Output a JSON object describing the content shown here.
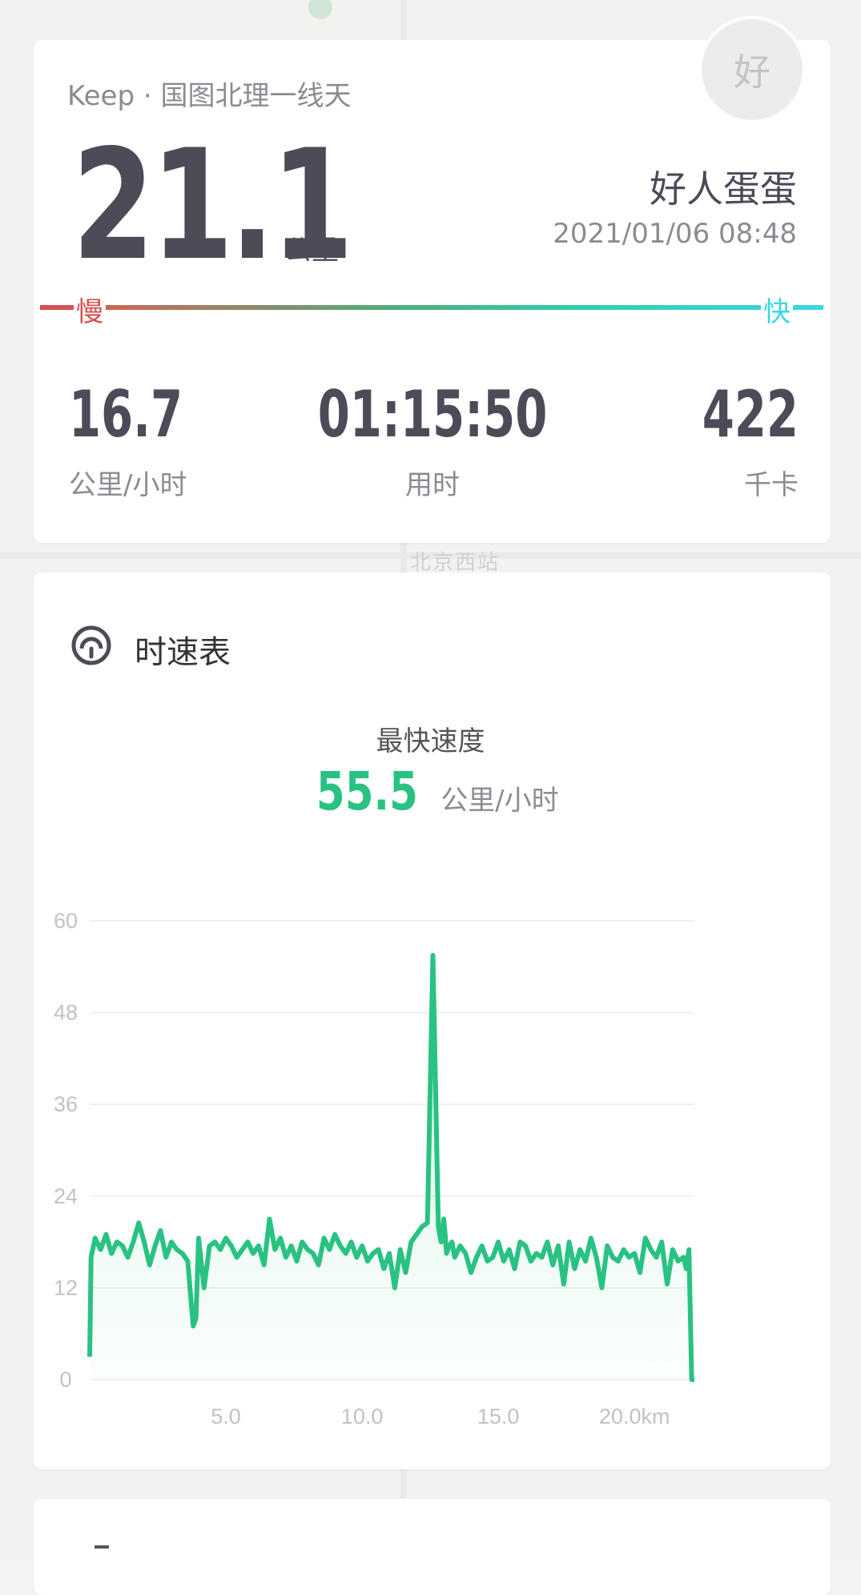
{
  "summary": {
    "source": "Keep · 国图北理一线天",
    "distance": "21.1",
    "distance_unit": "公里",
    "username": "好人蛋蛋",
    "datetime": "2021/01/06 08:48",
    "avatar_char": "好",
    "pace_slow": "慢",
    "pace_fast": "快",
    "stats": {
      "speed": {
        "value": "16.7",
        "label": "公里/小时"
      },
      "duration": {
        "value": "01:15:50",
        "label": "用时"
      },
      "calories": {
        "value": "422",
        "label": "千卡"
      }
    }
  },
  "background_map_label": "北京西站",
  "speed_section": {
    "title": "时速表",
    "max_label": "最快速度",
    "max_value": "55.5",
    "max_unit": "公里/小时"
  },
  "colors": {
    "accent_green": "#29c283",
    "text_dark": "#4e4a58",
    "slow_red": "#d94c4c",
    "fast_cyan": "#3ad7e6"
  },
  "chart_data": {
    "type": "area",
    "ylim": [
      0,
      60
    ],
    "xlim": [
      0,
      22.2
    ],
    "y_ticks": [
      "0",
      "12",
      "24",
      "36",
      "48",
      "60"
    ],
    "x_ticks": [
      {
        "value": 5.0,
        "label": "5.0"
      },
      {
        "value": 10.0,
        "label": "10.0"
      },
      {
        "value": 15.0,
        "label": "15.0"
      },
      {
        "value": 20.0,
        "label": "20.0km"
      }
    ],
    "grid": true,
    "series": [
      {
        "x": [
          0.0,
          0.05,
          0.2,
          0.4,
          0.6,
          0.8,
          1.0,
          1.2,
          1.4,
          1.6,
          1.8,
          2.0,
          2.2,
          2.4,
          2.6,
          2.8,
          3.0,
          3.2,
          3.4,
          3.6,
          3.8,
          3.9,
          4.0,
          4.2,
          4.4,
          4.6,
          4.8,
          5.0,
          5.2,
          5.4,
          5.6,
          5.8,
          6.0,
          6.2,
          6.4,
          6.6,
          6.8,
          7.0,
          7.2,
          7.4,
          7.6,
          7.8,
          8.0,
          8.2,
          8.4,
          8.6,
          8.8,
          9.0,
          9.2,
          9.4,
          9.6,
          9.8,
          10.0,
          10.2,
          10.4,
          10.6,
          10.8,
          11.0,
          11.2,
          11.4,
          11.6,
          11.8,
          12.0,
          12.2,
          12.4,
          12.6,
          12.8,
          12.9,
          13.0,
          13.05,
          13.1,
          13.2,
          13.3,
          13.4,
          13.6,
          13.8,
          14.0,
          14.2,
          14.4,
          14.6,
          14.8,
          15.0,
          15.2,
          15.4,
          15.6,
          15.8,
          16.0,
          16.2,
          16.4,
          16.6,
          16.8,
          17.0,
          17.2,
          17.4,
          17.6,
          17.8,
          18.0,
          18.2,
          18.4,
          18.6,
          18.8,
          19.0,
          19.2,
          19.4,
          19.6,
          19.8,
          20.0,
          20.2,
          20.4,
          20.6,
          20.8,
          21.0,
          21.2,
          21.4,
          21.6,
          21.8,
          21.9,
          22.0,
          22.1,
          22.2
        ],
        "y": [
          3.0,
          16.0,
          18.5,
          17.0,
          19.0,
          16.5,
          18.0,
          17.5,
          16.0,
          18.0,
          20.5,
          18.0,
          15.0,
          17.5,
          19.5,
          16.0,
          18.0,
          17.0,
          16.5,
          15.5,
          7.0,
          8.0,
          18.5,
          12.0,
          17.5,
          18.0,
          17.0,
          18.5,
          17.5,
          16.0,
          17.0,
          18.0,
          16.5,
          17.5,
          15.0,
          21.0,
          17.0,
          18.5,
          16.0,
          17.5,
          15.5,
          18.0,
          17.0,
          16.5,
          15.0,
          18.5,
          17.0,
          19.0,
          17.5,
          16.5,
          18.0,
          16.0,
          17.5,
          15.5,
          16.5,
          17.0,
          14.5,
          16.5,
          12.0,
          17.0,
          14.0,
          18.0,
          19.0,
          20.0,
          20.5,
          55.5,
          20.0,
          18.0,
          21.0,
          19.0,
          16.5,
          17.5,
          18.0,
          16.0,
          17.5,
          16.5,
          14.0,
          16.0,
          17.5,
          15.5,
          16.0,
          18.0,
          15.5,
          17.0,
          14.5,
          18.0,
          17.5,
          15.5,
          16.5,
          16.0,
          18.0,
          15.0,
          17.5,
          12.5,
          18.0,
          14.5,
          17.0,
          15.5,
          18.5,
          16.0,
          12.0,
          17.5,
          16.0,
          15.5,
          17.0,
          16.0,
          16.5,
          14.0,
          18.5,
          17.0,
          16.0,
          18.0,
          12.5,
          17.0,
          15.5,
          16.0,
          14.5,
          17.0,
          0.0,
          0.0
        ]
      }
    ]
  }
}
